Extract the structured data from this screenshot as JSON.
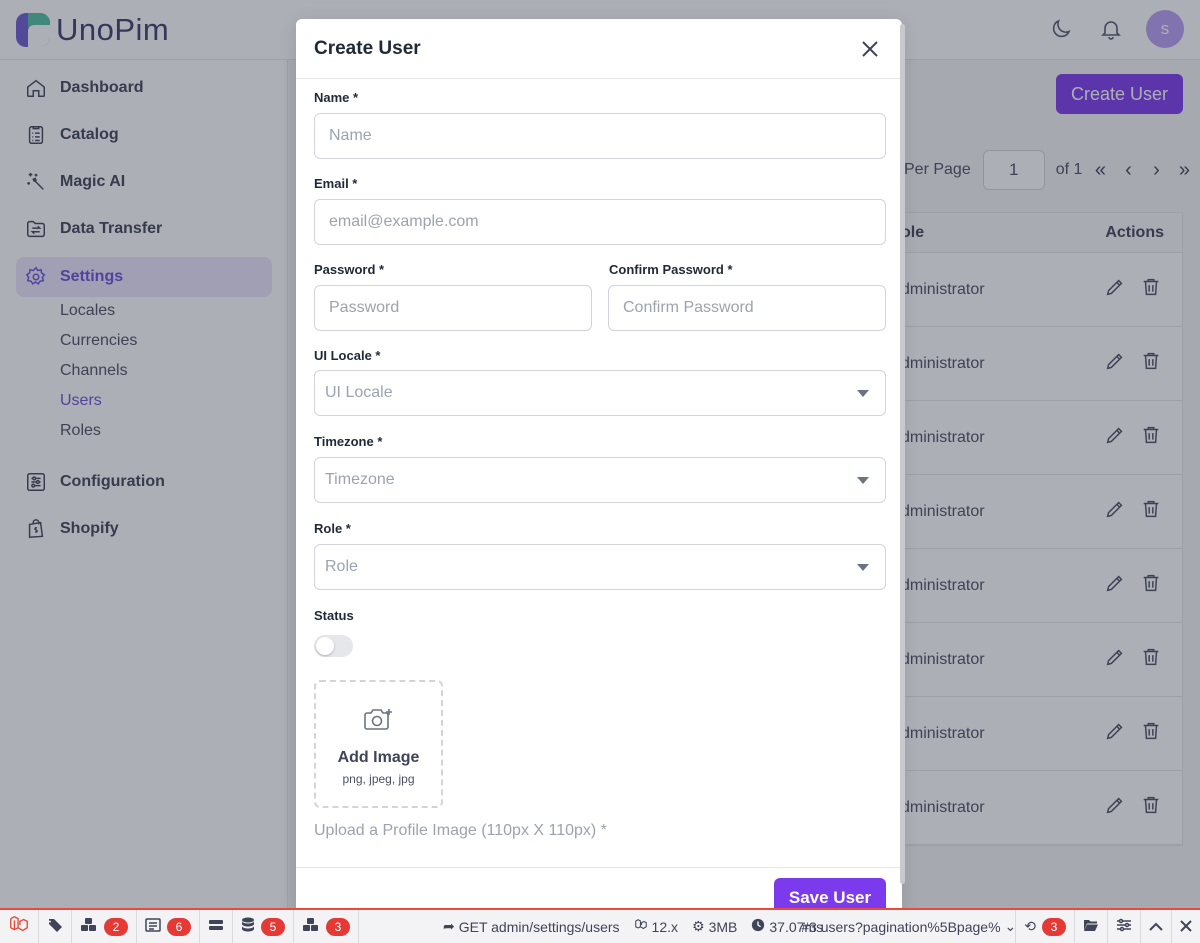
{
  "app": {
    "logo_text": "UnoPim",
    "avatar_letter": "s"
  },
  "sidebar": {
    "items": [
      {
        "label": "Dashboard",
        "icon": "home-icon"
      },
      {
        "label": "Catalog",
        "icon": "catalog-icon"
      },
      {
        "label": "Magic AI",
        "icon": "magic-wand-icon"
      },
      {
        "label": "Data Transfer",
        "icon": "data-transfer-icon"
      },
      {
        "label": "Settings",
        "icon": "gear-icon",
        "active": true
      },
      {
        "label": "Configuration",
        "icon": "sliders-icon"
      },
      {
        "label": "Shopify",
        "icon": "shopify-bag-icon"
      }
    ],
    "settings_sub": [
      "Locales",
      "Currencies",
      "Channels",
      "Users",
      "Roles"
    ],
    "active_sub": "Users"
  },
  "main": {
    "create_button": "Create User",
    "pager": {
      "per_page_label": "Per Page",
      "page_value": "1",
      "of_label": "of 1",
      "first": "«",
      "prev": "‹",
      "next": "›",
      "last": "»"
    },
    "table": {
      "head_role": "ole",
      "head_actions": "Actions",
      "rows": [
        "dministrator",
        "dministrator",
        "dministrator",
        "dministrator",
        "dministrator",
        "dministrator",
        "dministrator",
        "dministrator"
      ]
    }
  },
  "modal": {
    "title": "Create User",
    "fields": {
      "name": {
        "label": "Name *",
        "placeholder": "Name"
      },
      "email": {
        "label": "Email *",
        "placeholder": "email@example.com"
      },
      "password": {
        "label": "Password *",
        "placeholder": "Password"
      },
      "confirm_password": {
        "label": "Confirm Password *",
        "placeholder": "Confirm Password"
      },
      "ui_locale": {
        "label": "UI Locale *",
        "placeholder": "UI Locale"
      },
      "timezone": {
        "label": "Timezone *",
        "placeholder": "Timezone"
      },
      "role": {
        "label": "Role *",
        "placeholder": "Role"
      },
      "status": {
        "label": "Status",
        "enabled": false
      }
    },
    "upload": {
      "title": "Add Image",
      "formats": "png, jpeg, jpg",
      "help": "Upload a Profile Image (110px X 110px) *"
    },
    "save_button": "Save User"
  },
  "debugbar": {
    "badges": {
      "events": "2",
      "messages": "6",
      "queries": "5",
      "models": "3",
      "history": "3"
    },
    "request": "GET admin/settings/users",
    "version": "12.x",
    "memory": "3MB",
    "duration": "37.07ms",
    "request_select": "#3 users?pagination%5Bpage%"
  },
  "colors": {
    "accent": "#7c3aed",
    "sidebar_active_bg": "#ebe6fb",
    "debug_red": "#e53935"
  }
}
